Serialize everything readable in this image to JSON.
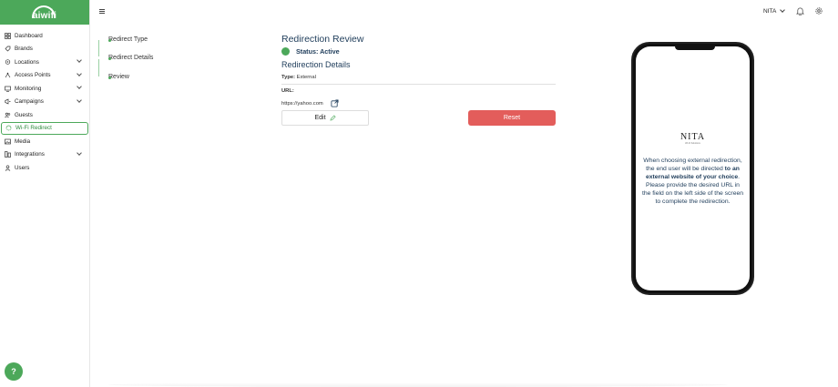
{
  "brand": {
    "logo_text": "aiwifi",
    "accent": "#4ca85a"
  },
  "sidebar": {
    "items": [
      {
        "label": "Dashboard",
        "icon": "dashboard-icon",
        "has_chevron": false
      },
      {
        "label": "Brands",
        "icon": "brand-icon",
        "has_chevron": false
      },
      {
        "label": "Locations",
        "icon": "location-pin-icon",
        "has_chevron": true
      },
      {
        "label": "Access Points",
        "icon": "access-point-icon",
        "has_chevron": true
      },
      {
        "label": "Monitoring",
        "icon": "monitor-icon",
        "has_chevron": true
      },
      {
        "label": "Campaigns",
        "icon": "megaphone-icon",
        "has_chevron": true
      },
      {
        "label": "Guests",
        "icon": "guests-icon",
        "has_chevron": false
      },
      {
        "label": "Wi-Fi Redirect",
        "icon": "redirect-icon",
        "has_chevron": false,
        "active": true
      },
      {
        "label": "Media",
        "icon": "media-icon",
        "has_chevron": false
      },
      {
        "label": "Integrations",
        "icon": "integrations-icon",
        "has_chevron": true
      },
      {
        "label": "Users",
        "icon": "user-icon",
        "has_chevron": false
      }
    ],
    "help_label": "?"
  },
  "topbar": {
    "user_name": "NITA"
  },
  "steps": [
    "Redirect Type",
    "Redirect Details",
    "Review"
  ],
  "review": {
    "title": "Redirection Review",
    "status": "Status: Active",
    "status_color": "#4ca85a",
    "details_title": "Redirection Details",
    "type_label": "Type:",
    "type_value": "External",
    "url_label": "URL:",
    "url_value": "https://yahoo.com",
    "edit_label": "Edit",
    "reset_label": "Reset",
    "reset_color": "#e35d5b"
  },
  "phone": {
    "brand": "NITA",
    "brand_sub": "Wi-Fi Solutions",
    "msg_1": "When choosing external redirection, the end user will be directed ",
    "msg_bold": "to an external website of your choice",
    "msg_2": ".",
    "msg_3": "Please provide the desired URL in the field on the left side of the screen to complete the redirection."
  }
}
